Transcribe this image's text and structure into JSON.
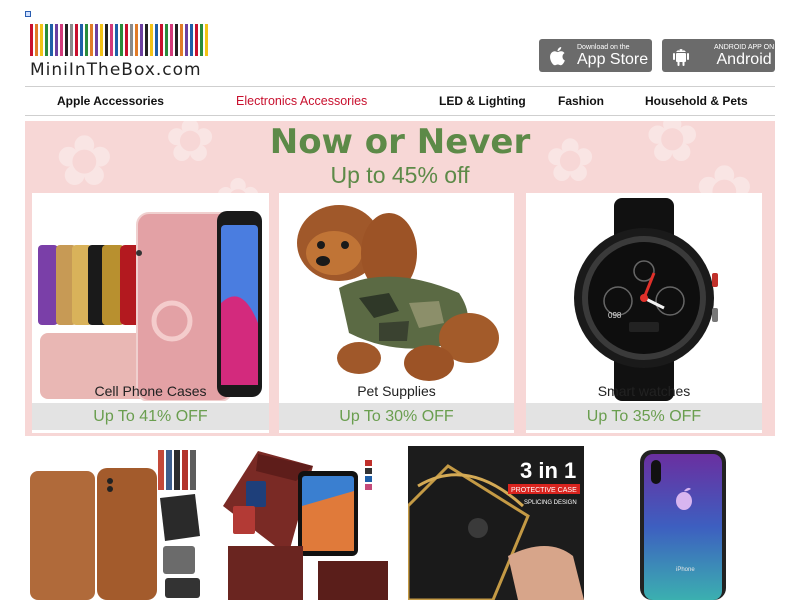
{
  "header": {
    "logo_text": "MiniInTheBox.com",
    "logo_stripe_colors": [
      "#c8102e",
      "#e07b28",
      "#f3c316",
      "#2a8c3b",
      "#1f5fa8",
      "#6b3fa0",
      "#d23a7a",
      "#222222",
      "#8a8a8a",
      "#c8102e",
      "#1f5fa8",
      "#2a8c3b",
      "#e07b28",
      "#6b3fa0",
      "#f3c316",
      "#222222",
      "#d23a7a",
      "#1f5fa8",
      "#2a8c3b",
      "#c8102e",
      "#8a8a8a",
      "#e07b28",
      "#6b3fa0",
      "#222222",
      "#f3c316",
      "#1f5fa8",
      "#c8102e",
      "#2a8c3b",
      "#d23a7a",
      "#222222",
      "#e07b28",
      "#6b3fa0",
      "#1f5fa8",
      "#c8102e",
      "#2a8c3b",
      "#f3c316"
    ],
    "app_store": {
      "small": "Download on the",
      "big": "App Store",
      "icon": "apple-icon"
    },
    "android": {
      "small": "ANDROID APP ON",
      "big": "Android",
      "icon": "android-icon"
    }
  },
  "nav": {
    "items": [
      {
        "label": "Apple Accessories",
        "active": false
      },
      {
        "label": "Electronics Accessories",
        "active": true
      },
      {
        "label": "LED & Lighting",
        "active": false
      },
      {
        "label": "Fashion",
        "active": false
      },
      {
        "label": "Household & Pets",
        "active": false
      }
    ],
    "active_color": "#c8102e"
  },
  "banner": {
    "headline": "Now or Never",
    "subline": "Up to 45% off",
    "accent_color": "#5d8a48",
    "background": "#f7d7d6",
    "cards": [
      {
        "name": "Cell Phone Cases",
        "discount": "Up To 41% OFF"
      },
      {
        "name": "Pet Supplies",
        "discount": "Up To 30% OFF"
      },
      {
        "name": "Smart watches",
        "discount": "Up To 35% OFF"
      }
    ]
  },
  "products": {
    "case_badge": {
      "big": "3 in 1",
      "small1": "PROTECTIVE CASE",
      "small2": "SPLICING DESIGN"
    },
    "watch_time": "098",
    "phone_label": "iPhone"
  }
}
